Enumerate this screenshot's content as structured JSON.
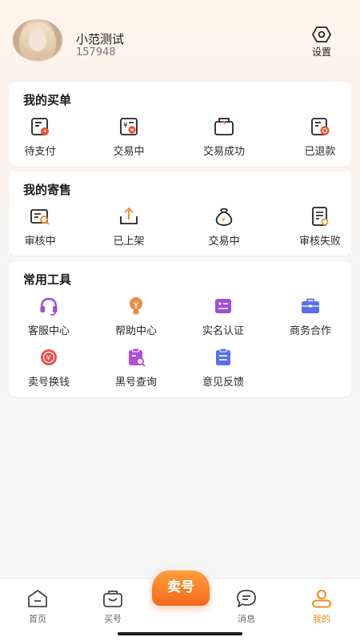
{
  "profile": {
    "name": "小范测试",
    "id": "157948",
    "settings_label": "设置"
  },
  "orders": {
    "title": "我的买单",
    "items": [
      {
        "label": "待支付",
        "icon": "wallet-clock-icon"
      },
      {
        "label": "交易中",
        "icon": "yuan-exchange-icon"
      },
      {
        "label": "交易成功",
        "icon": "yuan-box-icon"
      },
      {
        "label": "已退款",
        "icon": "refund-icon"
      }
    ]
  },
  "consign": {
    "title": "我的寄售",
    "items": [
      {
        "label": "审核中",
        "icon": "review-icon"
      },
      {
        "label": "已上架",
        "icon": "upload-tray-icon"
      },
      {
        "label": "交易中",
        "icon": "money-bag-icon"
      },
      {
        "label": "审核失败",
        "icon": "document-fail-icon"
      }
    ]
  },
  "tools": {
    "title": "常用工具",
    "items": [
      {
        "label": "客服中心",
        "icon": "headset-icon"
      },
      {
        "label": "帮助中心",
        "icon": "lightbulb-icon"
      },
      {
        "label": "实名认证",
        "icon": "id-card-icon"
      },
      {
        "label": "商务合作",
        "icon": "briefcase-icon"
      },
      {
        "label": "卖号换钱",
        "icon": "money-icon"
      },
      {
        "label": "黑号查询",
        "icon": "clipboard-search-icon"
      },
      {
        "label": "意见反馈",
        "icon": "feedback-icon"
      }
    ]
  },
  "tabbar": {
    "home": "首页",
    "buy": "买号",
    "sell": "卖号",
    "messages": "消息",
    "mine": "我的"
  },
  "colors": {
    "accent": "#ee8a1f",
    "sell_button": "#f5681d",
    "tool_purple": "#9b4de0",
    "tool_orange": "#ef8a44",
    "tool_blue": "#5a6ff0"
  }
}
